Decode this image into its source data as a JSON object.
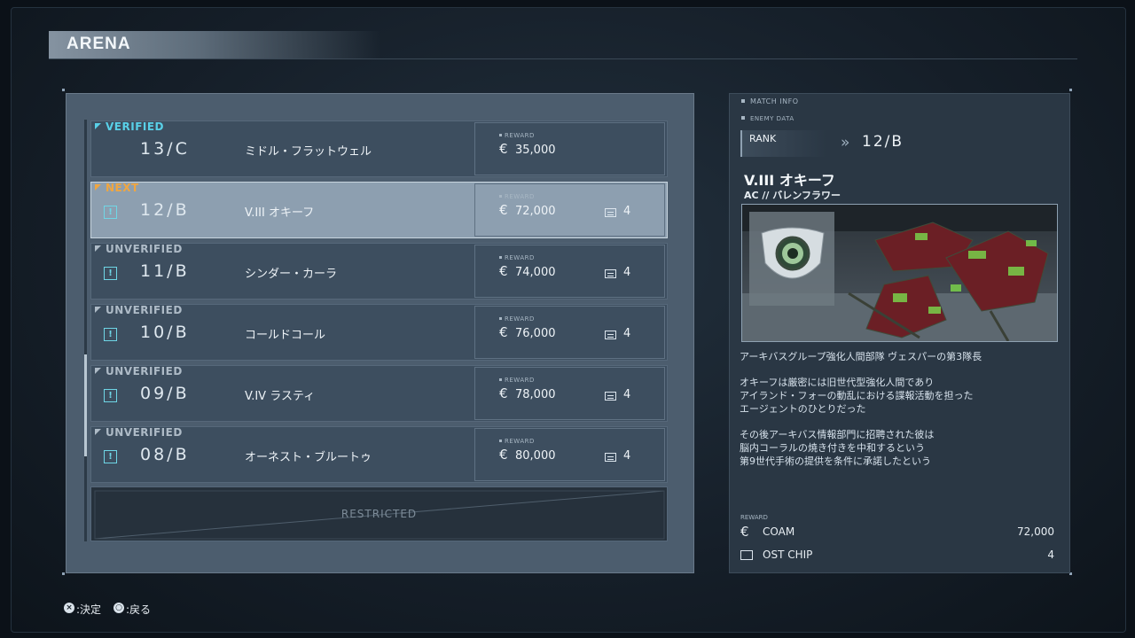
{
  "title": "ARENA",
  "entries": [
    {
      "status": "VERIFIED",
      "rank": "13/C",
      "name": "ミドル・フラットウェル",
      "reward_label": "REWARD",
      "reward": "35,000",
      "chips": ""
    },
    {
      "status": "NEXT",
      "rank": "12/B",
      "name": "V.III オキーフ",
      "reward_label": "REWARD",
      "reward": "72,000",
      "chips": "4"
    },
    {
      "status": "UNVERIFIED",
      "rank": "11/B",
      "name": "シンダー・カーラ",
      "reward_label": "REWARD",
      "reward": "74,000",
      "chips": "4"
    },
    {
      "status": "UNVERIFIED",
      "rank": "10/B",
      "name": "コールドコール",
      "reward_label": "REWARD",
      "reward": "76,000",
      "chips": "4"
    },
    {
      "status": "UNVERIFIED",
      "rank": "09/B",
      "name": "V.IV ラスティ",
      "reward_label": "REWARD",
      "reward": "78,000",
      "chips": "4"
    },
    {
      "status": "UNVERIFIED",
      "rank": "08/B",
      "name": "オーネスト・ブルートゥ",
      "reward_label": "REWARD",
      "reward": "80,000",
      "chips": "4"
    }
  ],
  "restricted": "RESTRICTED",
  "currency_symbol": "€",
  "info": {
    "section": "MATCH INFO",
    "subsection": "ENEMY DATA",
    "rank_label": "RANK",
    "rank_value": "12/B",
    "pilot": "V.III オキーフ",
    "ac": "AC // バレンフラワー",
    "desc1": "アーキバスグループ強化人間部隊 ヴェスパーの第3隊長",
    "desc2a": "オキーフは厳密には旧世代型強化人間であり",
    "desc2b": "アイランド・フォーの動乱における諜報活動を担った",
    "desc2c": "エージェントのひとりだった",
    "desc3a": "その後アーキバス情報部門に招聘された彼は",
    "desc3b": "脳内コーラルの焼き付きを中和するという",
    "desc3c": "第9世代手術の提供を条件に承諾したという",
    "reward_label": "REWARD",
    "coam_label": "COAM",
    "coam_value": "72,000",
    "chip_label": "OST CHIP",
    "chip_value": "4"
  },
  "hints": {
    "confirm": ":決定",
    "back": ":戻る"
  }
}
